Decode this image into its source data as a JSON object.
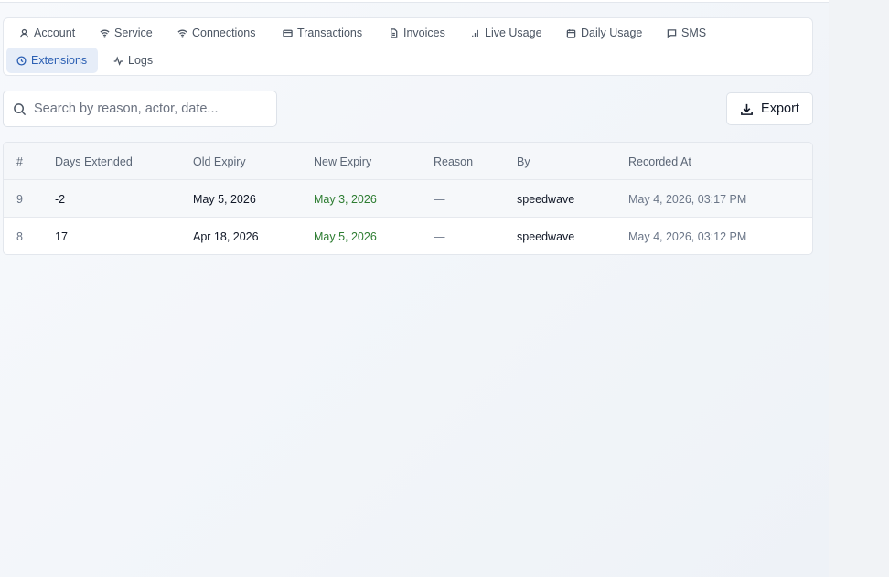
{
  "tabs": [
    {
      "label": "Account",
      "icon": "user-icon"
    },
    {
      "label": "Service",
      "icon": "wifi-icon"
    },
    {
      "label": "Connections",
      "icon": "wifi-icon"
    },
    {
      "label": "Transactions",
      "icon": "credit-card-icon"
    },
    {
      "label": "Invoices",
      "icon": "file-icon"
    },
    {
      "label": "Live Usage",
      "icon": "bar-chart-icon"
    },
    {
      "label": "Daily Usage",
      "icon": "calendar-icon"
    },
    {
      "label": "SMS",
      "icon": "message-icon"
    },
    {
      "label": "Extensions",
      "icon": "clock-icon",
      "active": true
    },
    {
      "label": "Logs",
      "icon": "activity-icon"
    }
  ],
  "search": {
    "placeholder": "Search by reason, actor, date...",
    "value": ""
  },
  "export": {
    "label": "Export"
  },
  "table": {
    "columns": [
      "#",
      "Days Extended",
      "Old Expiry",
      "New Expiry",
      "Reason",
      "By",
      "Recorded At"
    ],
    "rows": [
      {
        "id": "9",
        "days": "-2",
        "old_expiry": "May 5, 2026",
        "new_expiry": "May 3, 2026",
        "reason": "—",
        "by": "speedwave",
        "recorded_at": "May 4, 2026, 03:17 PM"
      },
      {
        "id": "8",
        "days": "17",
        "old_expiry": "Apr 18, 2026",
        "new_expiry": "May 5, 2026",
        "reason": "—",
        "by": "speedwave",
        "recorded_at": "May 4, 2026, 03:12 PM"
      }
    ]
  },
  "colors": {
    "accent": "#2b5fb3",
    "active_tab_bg": "#e6edf8",
    "positive": "#2e7d32"
  }
}
